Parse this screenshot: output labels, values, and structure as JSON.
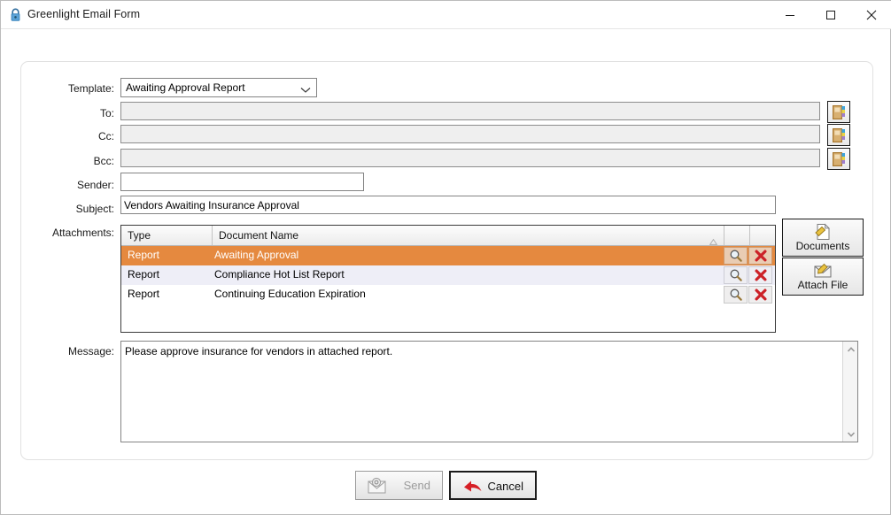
{
  "window": {
    "title": "Greenlight Email Form",
    "lock_icon": "lock-icon",
    "minimize_label": "Minimize",
    "maximize_label": "Maximize",
    "close_label": "Close"
  },
  "form": {
    "template": {
      "label": "Template:",
      "value": "Awaiting Approval Report",
      "chevron": "chevron-down-icon"
    },
    "to": {
      "label": "To:",
      "value": "",
      "placeholder": "",
      "book_icon": "address-book-icon"
    },
    "cc": {
      "label": "Cc:",
      "value": "",
      "placeholder": "",
      "book_icon": "address-book-icon"
    },
    "bcc": {
      "label": "Bcc:",
      "value": "",
      "placeholder": "",
      "book_icon": "address-book-icon"
    },
    "sender": {
      "label": "Sender:",
      "value": "",
      "placeholder": ""
    },
    "subject": {
      "label": "Subject:",
      "value": "Vendors Awaiting Insurance Approval",
      "placeholder": ""
    },
    "attachments": {
      "label": "Attachments:",
      "columns": [
        "Type",
        "Document Name",
        "",
        ""
      ],
      "sort_indicator": "sort-ascending-icon",
      "rows": [
        {
          "type": "Report",
          "name": "Awaiting Approval",
          "selected": true,
          "view_icon": "magnifier-icon",
          "remove_icon": "delete-x-icon"
        },
        {
          "type": "Report",
          "name": "Compliance Hot List Report",
          "selected": false,
          "view_icon": "magnifier-icon",
          "remove_icon": "delete-x-icon"
        },
        {
          "type": "Report",
          "name": "Continuing Education Expiration",
          "selected": false,
          "view_icon": "magnifier-icon",
          "remove_icon": "delete-x-icon"
        }
      ]
    },
    "documents_button": {
      "label": "Documents",
      "icon": "document-icon"
    },
    "attach_button": {
      "label": "Attach File",
      "icon": "attach-envelope-icon"
    },
    "message": {
      "label": "Message:",
      "value": "Please approve insurance for vendors in attached report.",
      "placeholder": "",
      "scroll_up_icon": "chevron-up-icon",
      "scroll_down_icon": "chevron-down-icon"
    }
  },
  "actions": {
    "send": {
      "label": "Send",
      "icon": "send-envelope-icon",
      "enabled": false
    },
    "cancel": {
      "label": "Cancel",
      "icon": "red-arrow-icon",
      "enabled": true
    }
  },
  "colors": {
    "selected_row": "#e5893f",
    "alt_row": "#eeeef7",
    "field_disabled": "#efefef",
    "accent_red": "#cc2127"
  }
}
